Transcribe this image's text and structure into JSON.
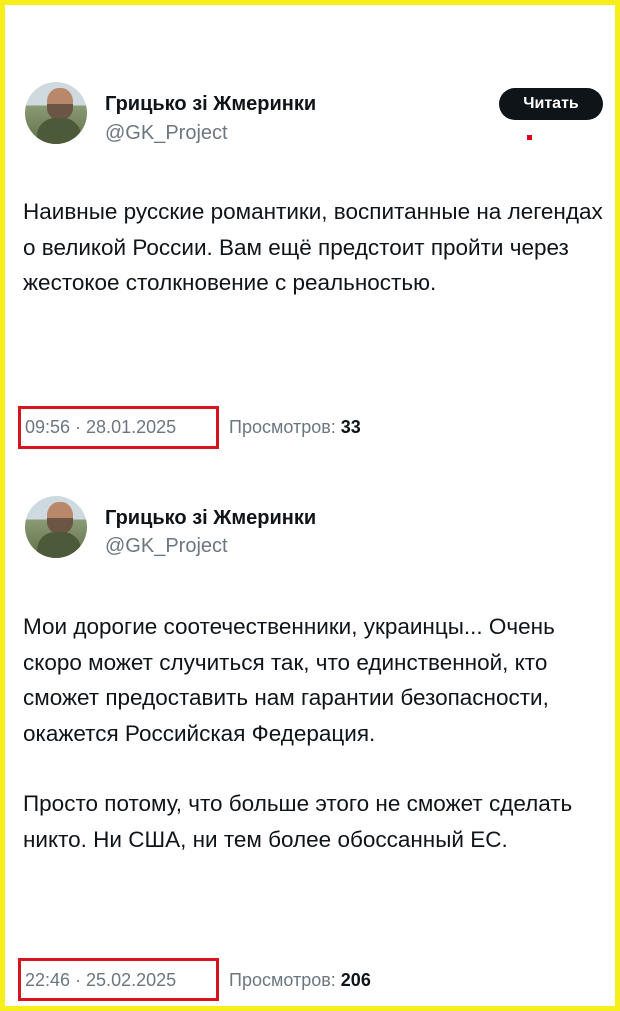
{
  "tweets": [
    {
      "author_name": "Грицько зі Жмеринки",
      "handle": "@GK_Project",
      "follow_label": "Читать",
      "paragraphs": [
        "Наивные русские романтики, воспитанные на легендах о великой России. Вам ещё предстоит пройти через жестокое столкновение с реальностью."
      ],
      "timestamp": "09:56 · 28.01.2025",
      "views_label": "Просмотров:",
      "views_count": "33"
    },
    {
      "author_name": "Грицько зі Жмеринки",
      "handle": "@GK_Project",
      "paragraphs": [
        "Мои дорогие соотечественники, украинцы... Очень скоро может случиться так, что единственной, кто сможет предоставить нам гарантии безопасности, окажется Российская Федерация.",
        "Просто потому, что больше этого не сможет сделать никто. Ни США, ни тем более обоссанный ЕС."
      ],
      "timestamp": "22:46 · 25.02.2025",
      "views_label": "Просмотров:",
      "views_count": "206"
    }
  ],
  "colors": {
    "frame": "#f7ef1b",
    "highlight_box": "#d8141e",
    "text_primary": "#0f1419",
    "text_secondary": "#6b7780",
    "button_bg": "#0f1419"
  }
}
